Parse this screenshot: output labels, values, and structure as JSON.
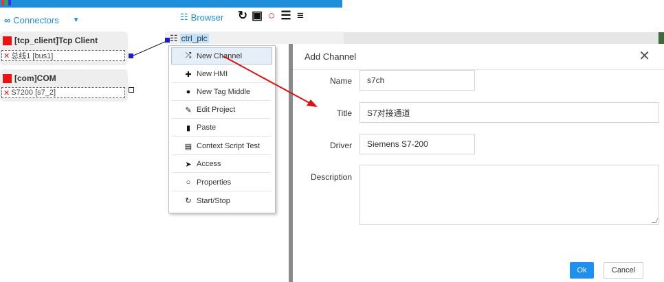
{
  "header": {
    "connectors_label": "Connectors",
    "browser_label": "Browser",
    "tool_icons": [
      "refresh-icon",
      "share-icon",
      "power-icon",
      "list-icon",
      "database-icon"
    ]
  },
  "connectors": [
    {
      "title": "[tcp_client]Tcp Client",
      "bus": "总线1 [bus1]"
    },
    {
      "title": "[com]COM",
      "bus": "S7200 [s7_2]"
    }
  ],
  "tree": {
    "node_label": "ctrl_plc"
  },
  "context_menu": {
    "items": [
      {
        "icon": "shuffle-icon",
        "label": "New Channel"
      },
      {
        "icon": "puzzle-icon",
        "label": "New HMI"
      },
      {
        "icon": "compass-icon",
        "label": "New Tag Middle"
      },
      {
        "icon": "pencil-icon",
        "label": "Edit Project"
      },
      {
        "icon": "clipboard-icon",
        "label": "Paste"
      },
      {
        "icon": "terminal-icon",
        "label": "Context Script Test"
      },
      {
        "icon": "send-icon",
        "label": "Access"
      },
      {
        "icon": "circle-icon",
        "label": "Properties"
      },
      {
        "icon": "refresh-icon",
        "label": "Start/Stop"
      }
    ]
  },
  "dialog": {
    "title": "Add Channel",
    "fields": {
      "name_label": "Name",
      "name_value": "s7ch",
      "title_label": "Title",
      "title_value": "S7对接通道",
      "driver_label": "Driver",
      "driver_value": "Siemens S7-200",
      "description_label": "Description",
      "description_value": ""
    },
    "ok_label": "Ok",
    "cancel_label": "Cancel"
  },
  "colors": {
    "accent": "#1e8fdb",
    "danger": "#ee1111",
    "ok_button": "#1e90f0"
  }
}
